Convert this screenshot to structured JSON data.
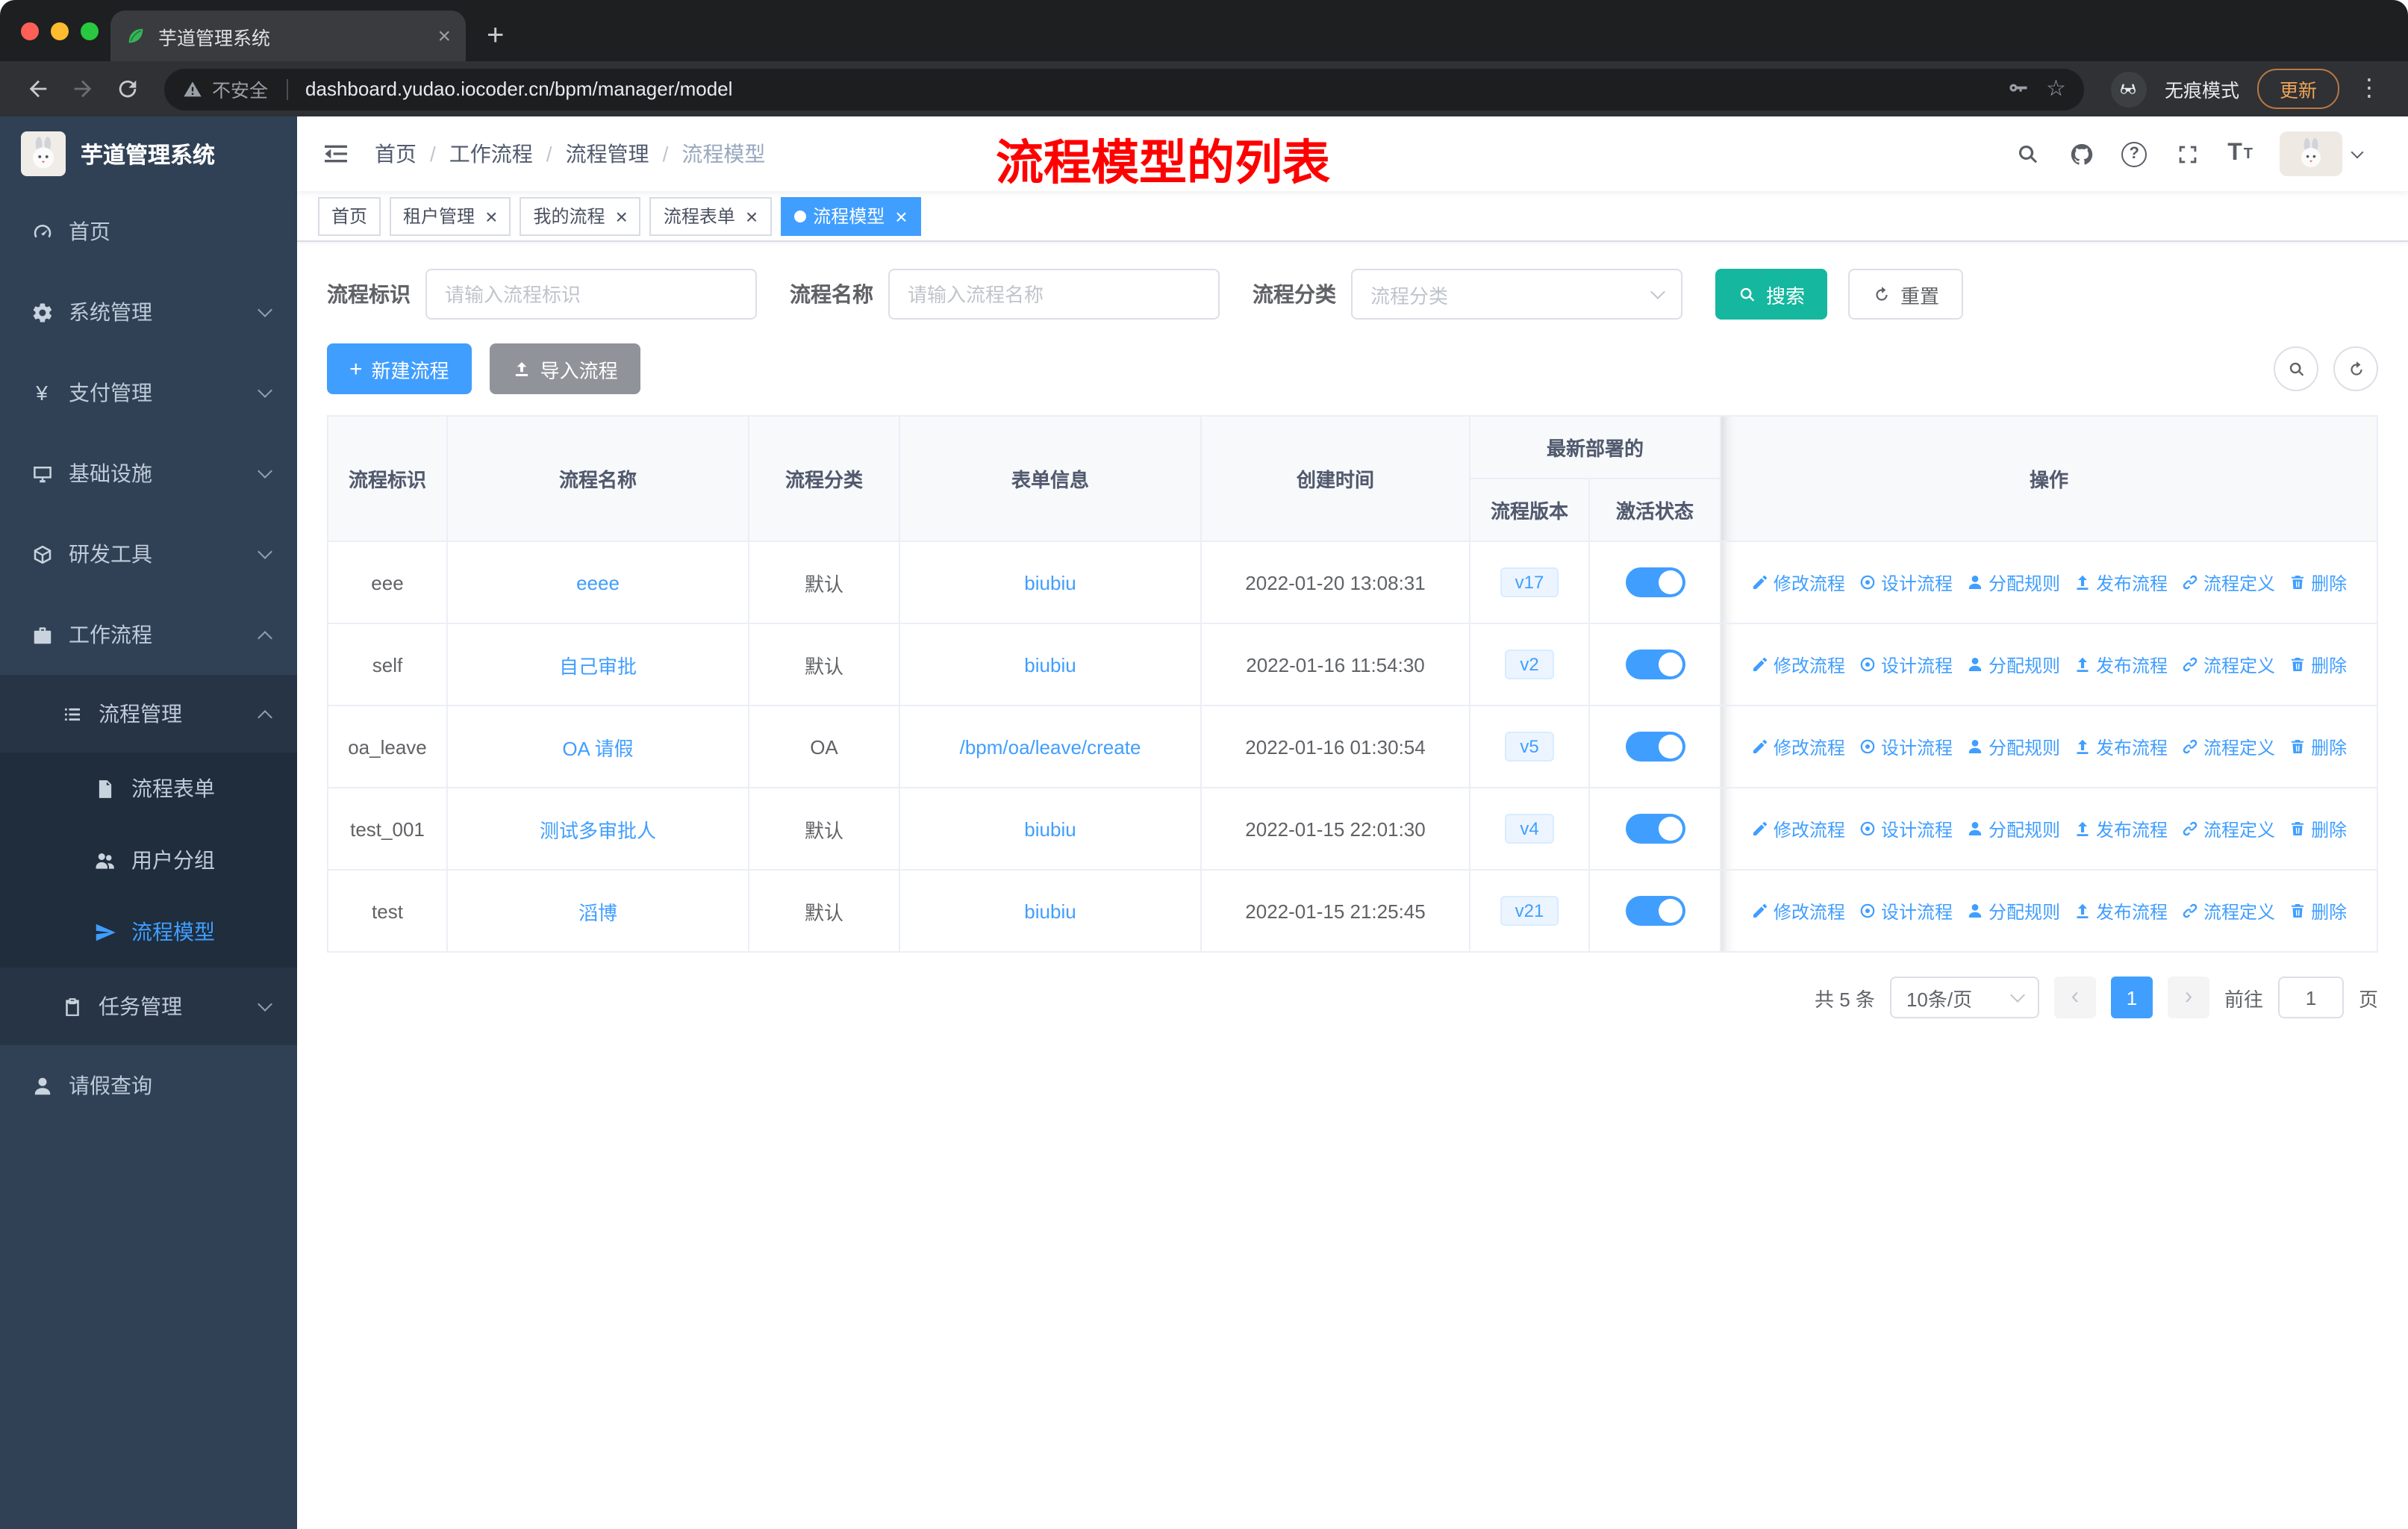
{
  "colors": {
    "accent": "#409eff",
    "search_btn": "#15b79f",
    "import_btn": "#909399",
    "sidebar_bg": "#304156",
    "sidebar_sub_bg": "#263445",
    "sidebar_sub2_bg": "#1f2d3d",
    "annotation_red": "#ff0000"
  },
  "browser": {
    "tab_title": "芋道管理系统",
    "security_label": "不安全",
    "url": "dashboard.yudao.iocoder.cn/bpm/manager/model",
    "incognito_label": "无痕模式",
    "update_label": "更新"
  },
  "sidebar": {
    "logo_title": "芋道管理系统",
    "items": [
      {
        "label": "首页",
        "icon": "dashboard-icon"
      },
      {
        "label": "系统管理",
        "icon": "gear-icon",
        "expandable": true
      },
      {
        "label": "支付管理",
        "icon": "yen-icon",
        "expandable": true
      },
      {
        "label": "基础设施",
        "icon": "infrastructure-icon",
        "expandable": true
      },
      {
        "label": "研发工具",
        "icon": "tools-icon",
        "expandable": true
      },
      {
        "label": "工作流程",
        "icon": "workflow-icon",
        "expanded": true,
        "children": [
          {
            "label": "流程管理",
            "icon": "process-management-icon",
            "expanded": true,
            "children": [
              {
                "label": "流程表单",
                "icon": "form-icon"
              },
              {
                "label": "用户分组",
                "icon": "user-group-icon"
              },
              {
                "label": "流程模型",
                "icon": "model-icon",
                "active": true
              }
            ]
          },
          {
            "label": "任务管理",
            "icon": "task-icon",
            "expandable": true
          }
        ]
      },
      {
        "label": "请假查询",
        "icon": "leave-icon"
      }
    ]
  },
  "header": {
    "breadcrumb": [
      "首页",
      "工作流程",
      "流程管理",
      "流程模型"
    ],
    "annotation": "流程模型的列表"
  },
  "tags": [
    {
      "label": "首页",
      "closable": false,
      "active": false
    },
    {
      "label": "租户管理",
      "closable": true,
      "active": false
    },
    {
      "label": "我的流程",
      "closable": true,
      "active": false
    },
    {
      "label": "流程表单",
      "closable": true,
      "active": false
    },
    {
      "label": "流程模型",
      "closable": true,
      "active": true
    }
  ],
  "filters": {
    "process_id_label": "流程标识",
    "process_id_placeholder": "请输入流程标识",
    "process_name_label": "流程名称",
    "process_name_placeholder": "请输入流程名称",
    "category_label": "流程分类",
    "category_placeholder": "流程分类",
    "search_button": "搜索",
    "reset_button": "重置"
  },
  "toolbar": {
    "create_button": "新建流程",
    "import_button": "导入流程"
  },
  "table": {
    "columns": [
      "流程标识",
      "流程名称",
      "流程分类",
      "表单信息",
      "创建时间"
    ],
    "group_header": "最新部署的",
    "sub_columns": [
      "流程版本",
      "激活状态"
    ],
    "actions_header": "操作",
    "actions": [
      {
        "name": "modify-process-link",
        "icon": "edit-icon",
        "label": "修改流程"
      },
      {
        "name": "design-process-link",
        "icon": "design-icon",
        "label": "设计流程"
      },
      {
        "name": "assign-rule-link",
        "icon": "assign-icon",
        "label": "分配规则"
      },
      {
        "name": "publish-process-link",
        "icon": "publish-icon",
        "label": "发布流程"
      },
      {
        "name": "process-definition-link",
        "icon": "definition-icon",
        "label": "流程定义"
      },
      {
        "name": "delete-link",
        "icon": "delete-icon",
        "label": "删除"
      }
    ],
    "rows": [
      {
        "id": "eee",
        "name": "eeee",
        "category": "默认",
        "form": "biubiu",
        "created": "2022-01-20 13:08:31",
        "version": "v17",
        "active": true
      },
      {
        "id": "self",
        "name": "自己审批",
        "category": "默认",
        "form": "biubiu",
        "created": "2022-01-16 11:54:30",
        "version": "v2",
        "active": true
      },
      {
        "id": "oa_leave",
        "name": "OA 请假",
        "category": "OA",
        "form": "/bpm/oa/leave/create",
        "created": "2022-01-16 01:30:54",
        "version": "v5",
        "active": true
      },
      {
        "id": "test_001",
        "name": "测试多审批人",
        "category": "默认",
        "form": "biubiu",
        "created": "2022-01-15 22:01:30",
        "version": "v4",
        "active": true
      },
      {
        "id": "test",
        "name": "滔博",
        "category": "默认",
        "form": "biubiu",
        "created": "2022-01-15 21:25:45",
        "version": "v21",
        "active": true
      }
    ]
  },
  "pagination": {
    "total": "共 5 条",
    "page_size": "10条/页",
    "current_page": "1",
    "goto_label": "前往",
    "goto_value": "1",
    "unit_label": "页"
  }
}
